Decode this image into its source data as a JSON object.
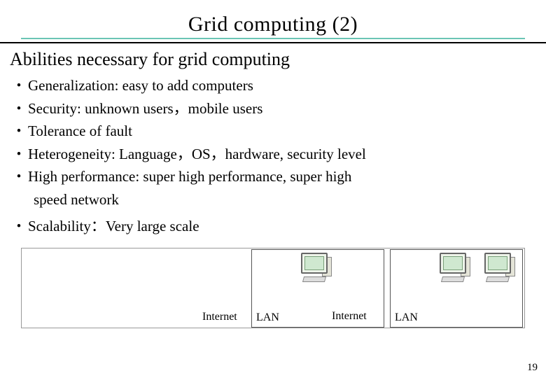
{
  "title": "Grid computing (2)",
  "subtitle": "Abilities necessary for grid computing",
  "bullets": [
    "Generalization: easy to add computers",
    "Security:  unknown users，mobile users",
    "Tolerance of fault",
    "Heterogeneity: Language，OS，hardware, security level",
    " High performance: super high performance, super high"
  ],
  "bullet_cont": "speed network",
  "bullet_last": "Scalability：Very large scale",
  "diagram": {
    "lan": "LAN",
    "internet": "Internet"
  },
  "page_number": "19"
}
